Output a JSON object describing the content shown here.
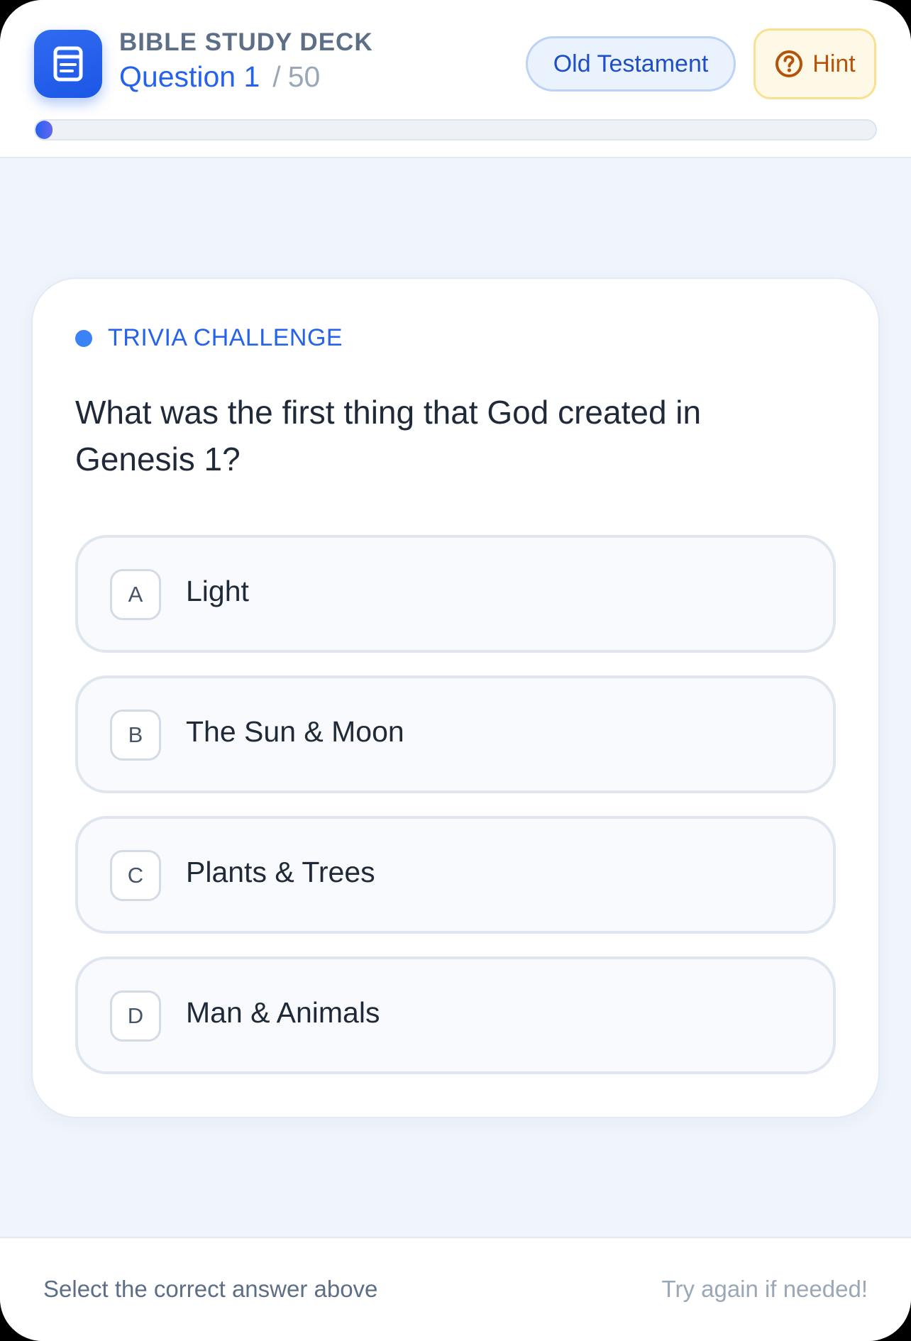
{
  "header": {
    "deck_title": "BIBLE STUDY DECK",
    "question_label": "Question 1",
    "separator": "/",
    "total": "50",
    "category": "Old Testament",
    "hint_label": "Hint",
    "progress": 0.02
  },
  "card": {
    "tag": "TRIVIA CHALLENGE",
    "question": "What was the first thing that God created in Genesis 1?",
    "options": [
      {
        "letter": "A",
        "text": "Light"
      },
      {
        "letter": "B",
        "text": "The Sun & Moon"
      },
      {
        "letter": "C",
        "text": "Plants & Trees"
      },
      {
        "letter": "D",
        "text": "Man & Animals"
      }
    ]
  },
  "footer": {
    "instruction": "Select the correct answer above",
    "encouragement": "Try again if needed!"
  },
  "colors": {
    "accent": "#2563eb",
    "hint": "#b45309",
    "background": "#f0f5fc"
  },
  "icons": {
    "app": "book-icon",
    "hint": "question-circle-icon"
  }
}
